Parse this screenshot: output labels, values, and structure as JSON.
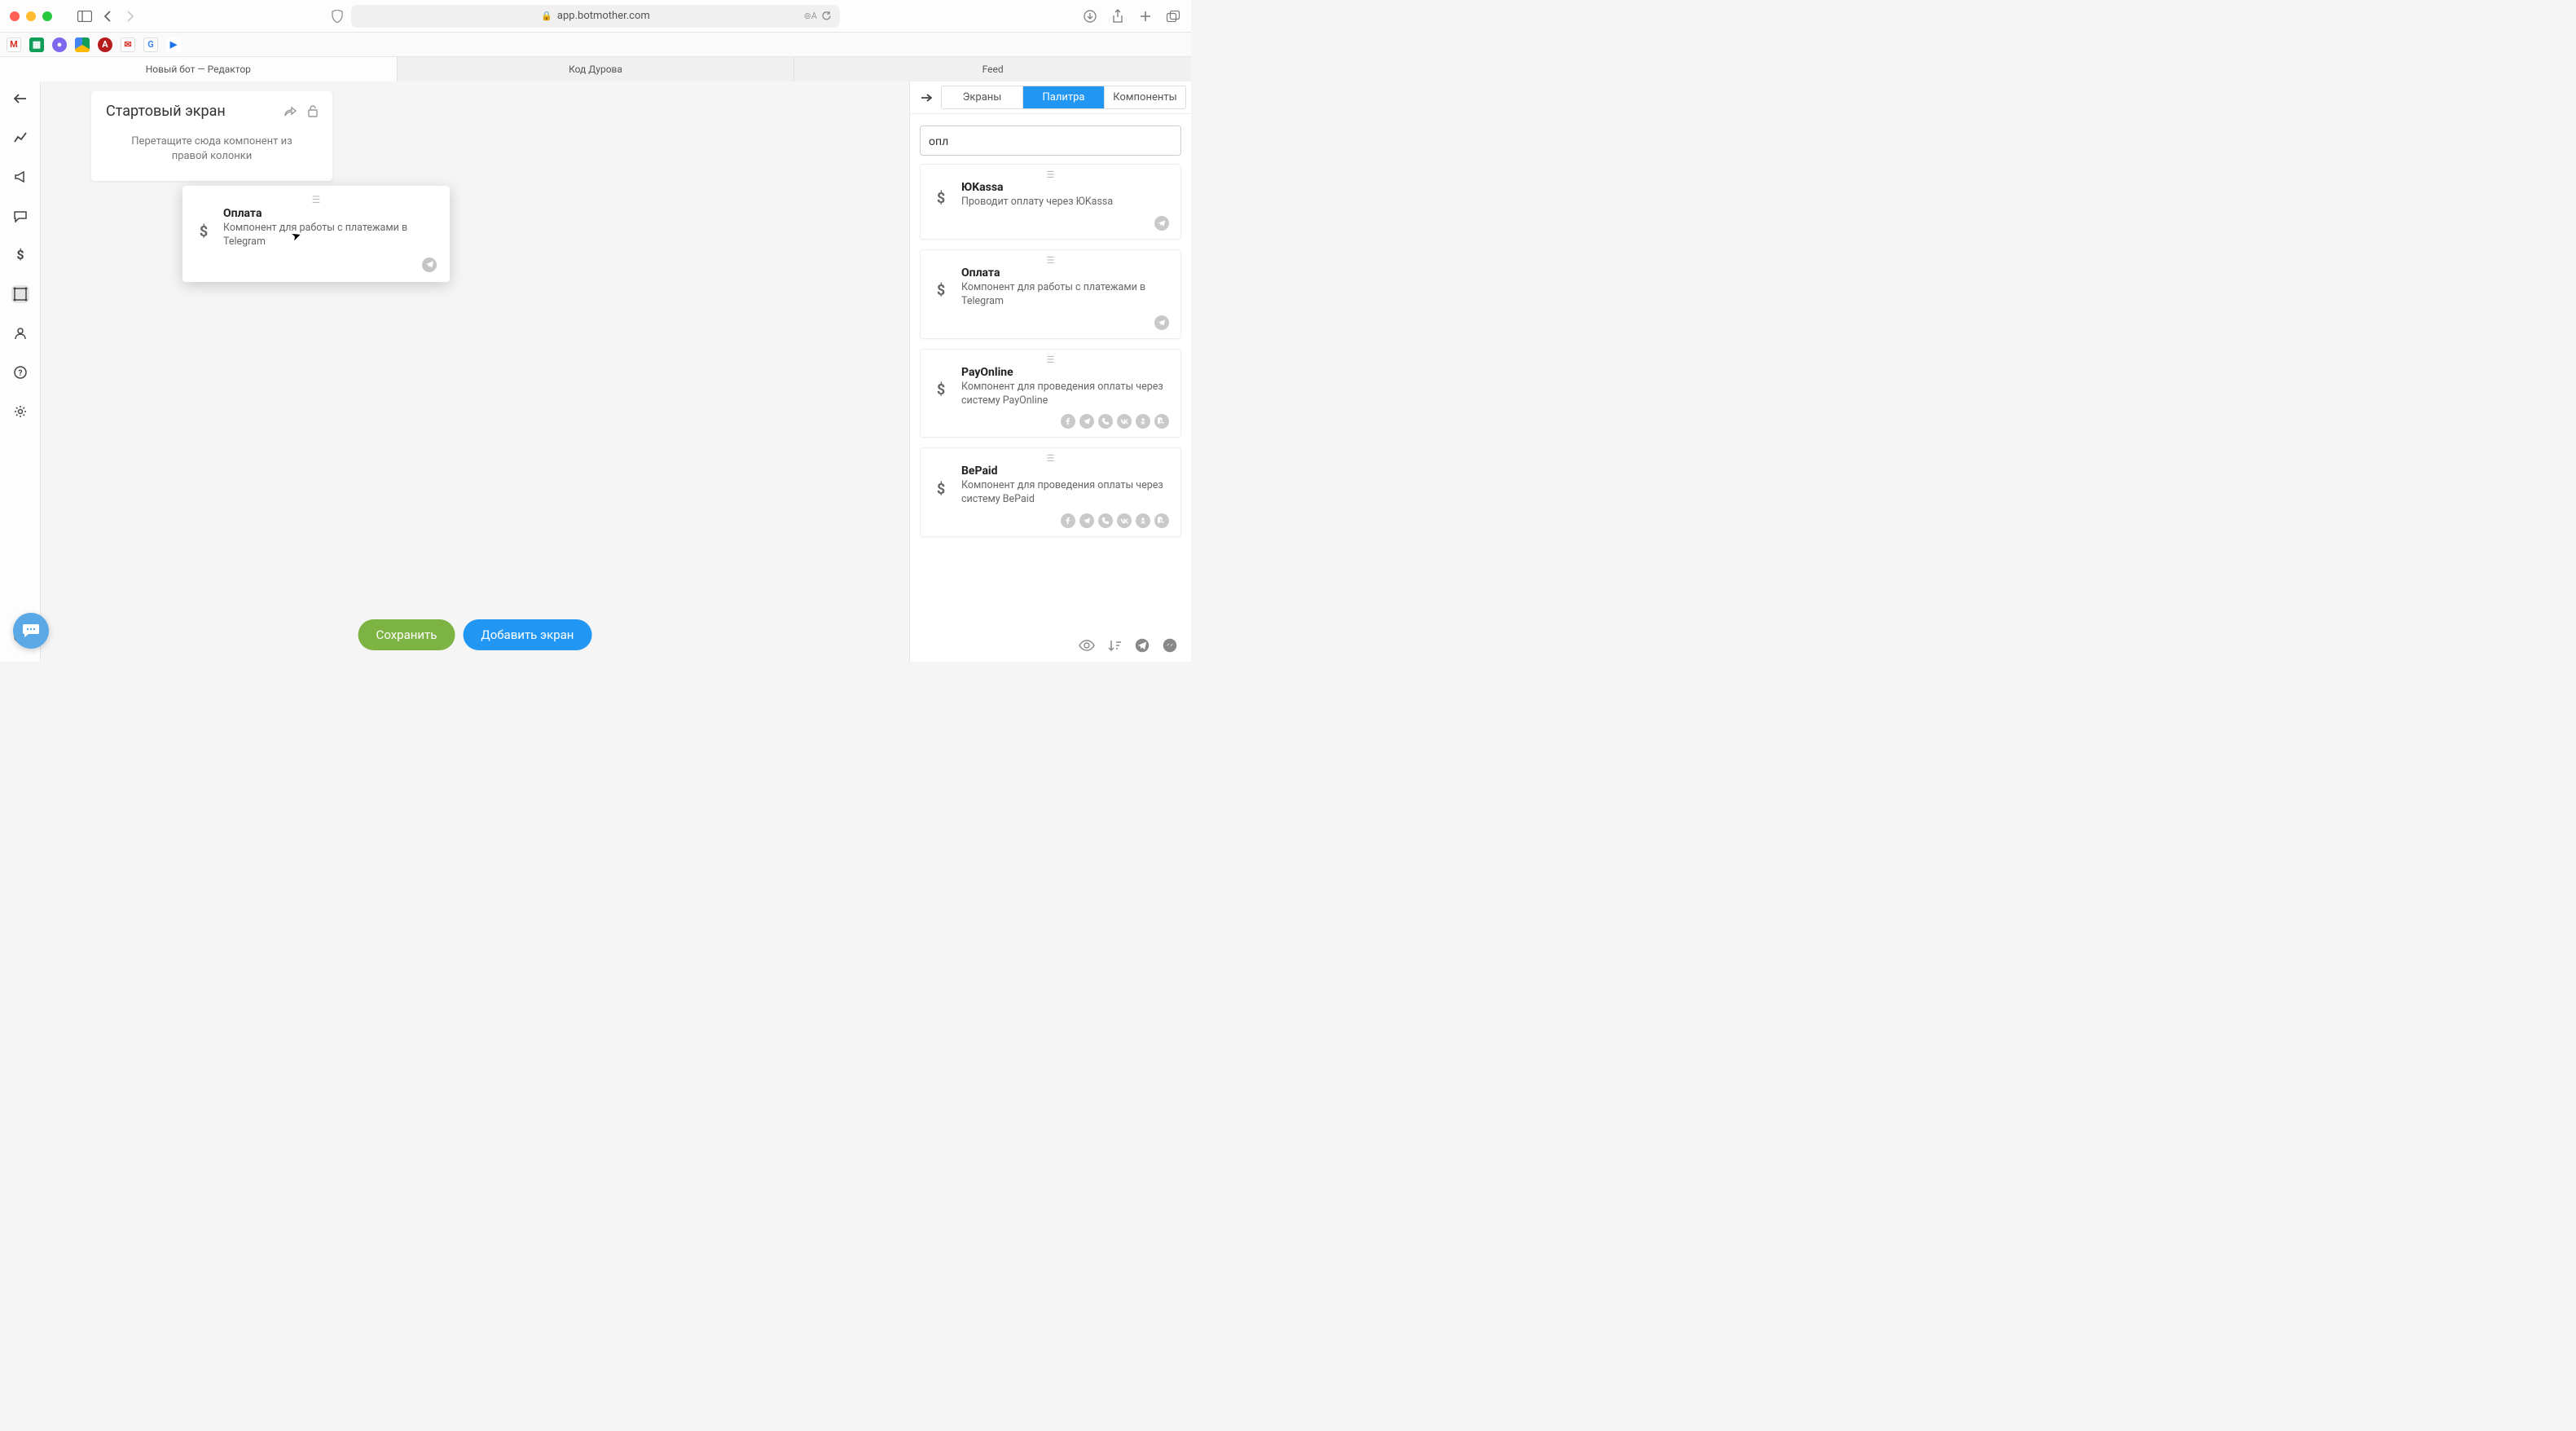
{
  "browser": {
    "url_host": "app.botmother.com",
    "tabs": [
      {
        "label": "Новый бот — Редактор"
      },
      {
        "label": "Код Дурова"
      },
      {
        "label": "Feed"
      }
    ]
  },
  "screen_card": {
    "title": "Стартовый экран",
    "drop_hint": "Перетащите сюда компонент из правой колонки"
  },
  "dragging": {
    "title": "Оплата",
    "desc": "Компонент для работы с платежами в Telegram"
  },
  "right_panel": {
    "tabs": {
      "screens": "Экраны",
      "palette": "Палитра",
      "components": "Компоненты"
    },
    "search_value": "опл",
    "items": [
      {
        "title": "ЮKassa",
        "desc": "Проводит оплату через ЮKassa",
        "channels": [
          "telegram"
        ]
      },
      {
        "title": "Оплата",
        "desc": "Компонент для работы с платежами в Telegram",
        "channels": [
          "telegram"
        ]
      },
      {
        "title": "PayOnline",
        "desc": "Компонент для проведения оплаты через систему PayOnline",
        "channels": [
          "facebook",
          "telegram",
          "viber",
          "vk",
          "ok",
          "whatsapp"
        ]
      },
      {
        "title": "BePaid",
        "desc": "Компонент для проведения оплаты через систему BePaid",
        "channels": [
          "facebook",
          "telegram",
          "viber",
          "vk",
          "ok",
          "whatsapp"
        ]
      }
    ]
  },
  "buttons": {
    "save": "Сохранить",
    "add_screen": "Добавить экран"
  }
}
